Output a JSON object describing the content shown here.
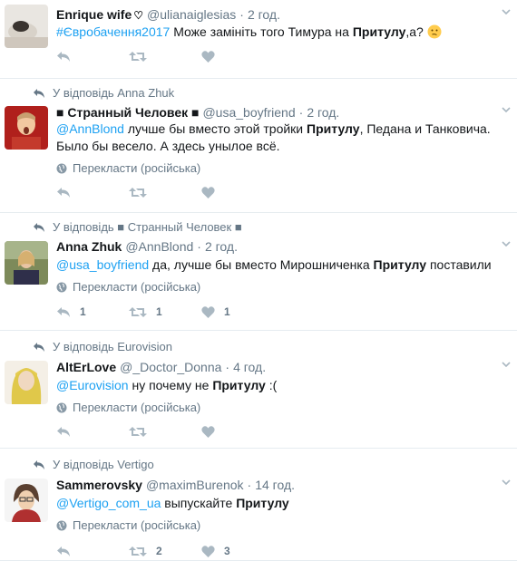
{
  "tweets": [
    {
      "author": "Enrique wife",
      "author_heart": "♡",
      "handle": "@ulianaiglesias",
      "time": "2 год.",
      "hashtag": "#Євробачення2017",
      "text_before": " Може замініть того Тимура на ",
      "bold": "Притулу",
      "text_after": ",а?",
      "emoji": "thinking-face",
      "replies": "",
      "retweets": "",
      "likes": ""
    },
    {
      "reply_to": "У відповідь Anna Zhuk",
      "author": "■ Странный Человек ■",
      "handle": "@usa_boyfriend",
      "time": "2 год.",
      "mention": "@AnnBlond",
      "text_before": " лучше бы вместо этой тройки ",
      "bold": "Притулу",
      "text_after": ", Педана и Танковича. Было бы весело. А здесь унылое всё.",
      "translate": "Перекласти (російська)",
      "replies": "",
      "retweets": "",
      "likes": ""
    },
    {
      "reply_to": "У відповідь ■ Странный Человек ■",
      "author": "Anna Zhuk",
      "handle": "@AnnBlond",
      "time": "2 год.",
      "mention": "@usa_boyfriend",
      "text_before": " да, лучше бы вместо Мирошниченка ",
      "bold": "Притулу",
      "text_after": " поставили",
      "translate": "Перекласти (російська)",
      "replies": "1",
      "retweets": "1",
      "likes": "1"
    },
    {
      "reply_to": "У відповідь Eurovision",
      "author": "AltErLove",
      "handle": "@_Doctor_Donna",
      "time": "4 год.",
      "mention": "@Eurovision",
      "text_before": " ну почему не ",
      "bold": "Притулу",
      "text_after": " :(",
      "translate": "Перекласти (російська)",
      "replies": "",
      "retweets": "",
      "likes": ""
    },
    {
      "reply_to": "У відповідь Vertigo",
      "author": "Sammerovsky",
      "handle": "@maximBurenok",
      "time": "14 год.",
      "mention": "@Vertigo_com_ua",
      "text_before": " выпускайте ",
      "bold": "Притулу",
      "text_after": "",
      "translate": "Перекласти (російська)",
      "replies": "",
      "retweets": "2",
      "likes": "3"
    }
  ],
  "separator": "·",
  "colors": {
    "link": "#1da1f2",
    "secondary": "#657786",
    "icon": "#aab8c2",
    "border": "#e6ecf0"
  }
}
